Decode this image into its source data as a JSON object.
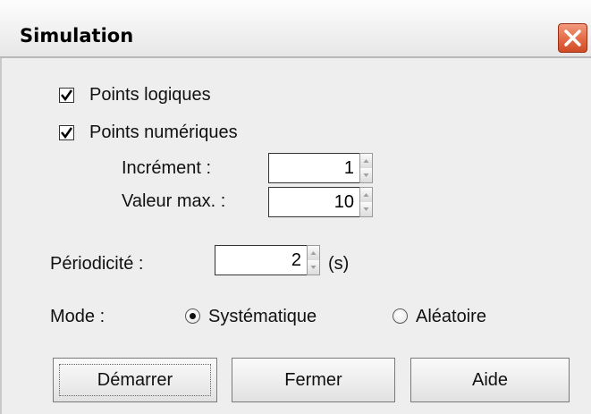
{
  "window": {
    "title": "Simulation",
    "close_icon": "close-x-icon",
    "close_color": "#e3693f"
  },
  "options": {
    "logical_points": {
      "label": "Points logiques",
      "checked": true
    },
    "numeric_points": {
      "label": "Points numériques",
      "checked": true
    },
    "increment": {
      "label": "Incrément :",
      "value": "1"
    },
    "max_value": {
      "label": "Valeur max. :",
      "value": "10"
    }
  },
  "periodicity": {
    "label": "Périodicité :",
    "value": "2",
    "unit": "(s)"
  },
  "mode": {
    "label": "Mode :",
    "options": [
      {
        "label": "Systématique",
        "selected": true
      },
      {
        "label": "Aléatoire",
        "selected": false
      }
    ]
  },
  "buttons": {
    "start": "Démarrer",
    "close": "Fermer",
    "help": "Aide"
  }
}
